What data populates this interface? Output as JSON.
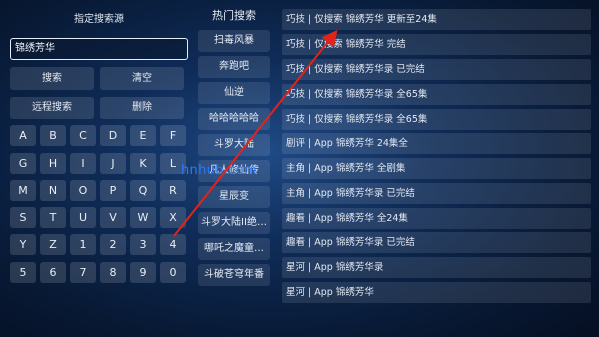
{
  "left_panel": {
    "title": "指定搜索源",
    "search_value": "锦绣芳华",
    "buttons": {
      "search": "搜索",
      "clear": "清空",
      "remote_search": "远程搜索",
      "delete": "删除"
    },
    "keys": [
      "A",
      "B",
      "C",
      "D",
      "E",
      "F",
      "G",
      "H",
      "I",
      "J",
      "K",
      "L",
      "M",
      "N",
      "O",
      "P",
      "Q",
      "R",
      "S",
      "T",
      "U",
      "V",
      "W",
      "X",
      "Y",
      "Z",
      "1",
      "2",
      "3",
      "4",
      "5",
      "6",
      "7",
      "8",
      "9",
      "0"
    ]
  },
  "hot_panel": {
    "header": "热门搜索",
    "items": [
      "扫毒风暴",
      "奔跑吧",
      "仙逆",
      "哈哈哈哈哈",
      "斗罗大陆",
      "凡人修仙传",
      "星辰变",
      "斗罗大陆II绝…",
      "哪吒之魔童…",
      "斗破苍穹年番"
    ]
  },
  "results": [
    "巧技 | 仅搜索 锦绣芳华 更新至24集",
    "巧技 | 仅搜索 锦绣芳华 完结",
    "巧技 | 仅搜索 锦绣芳华录 已完结",
    "巧技 | 仅搜索 锦绣芳华录 全65集",
    "巧技 | 仅搜索 锦绣芳华录 全65集",
    "剧评 | App 锦绣芳华 24集全",
    "主角 | App 锦绣芳华 全剧集",
    "主角 | App 锦绣芳华录 已完结",
    "趣看 | App 锦绣芳华 全24集",
    "趣看 | App 锦绣芳华录 已完结",
    "星河 | App 锦绣芳华录",
    "星河 | App 锦绣芳华"
  ],
  "watermark": "hnhub.com",
  "colors": {
    "arrow": "#e2231a",
    "watermark": "#2b7bff"
  }
}
